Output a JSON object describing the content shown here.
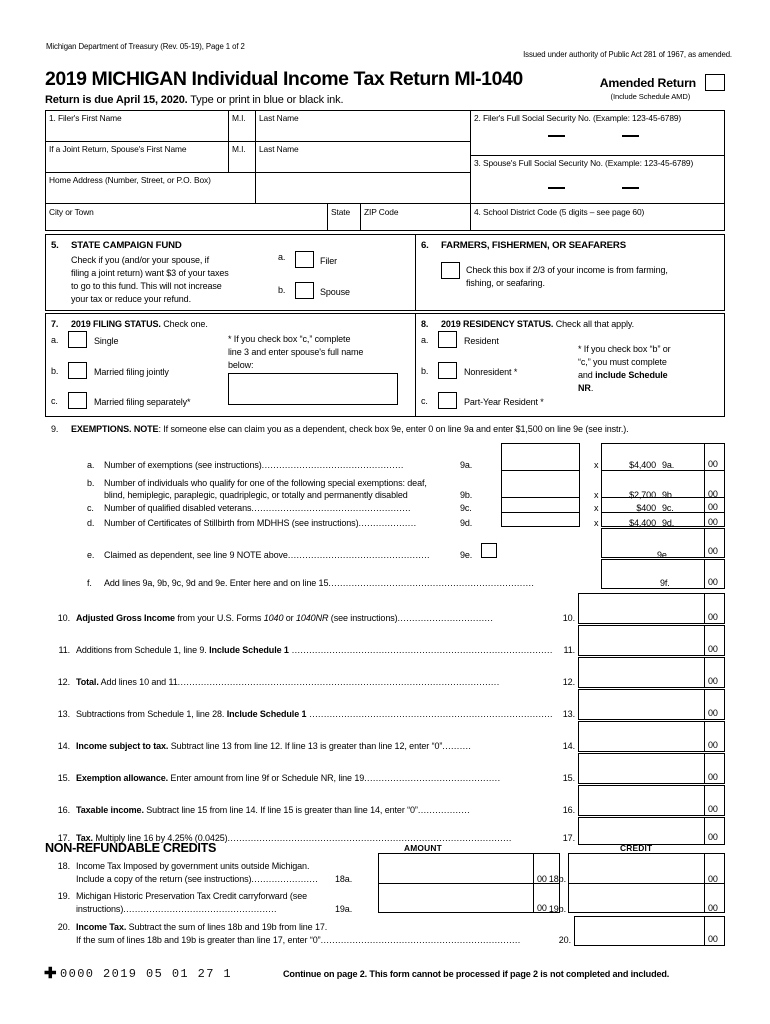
{
  "header": {
    "dept_line": "Michigan Department of Treasury (Rev. 05-19), Page 1 of 2",
    "authority_line": "Issued under authority of Public Act 281 of 1967, as amended.",
    "title": "2019 MICHIGAN Individual Income Tax Return MI-1040",
    "due_bold": "Return is due April 15, 2020.",
    "due_rest": " Type or print in blue or black ink.",
    "amended_label": "Amended Return",
    "amended_sub": "(Include Schedule AMD)"
  },
  "identity": {
    "filer_first_name": "1. Filer's First Name",
    "mi": "M.I.",
    "last_name": "Last Name",
    "spouse_first_name": "If a Joint Return, Spouse's First Name",
    "mi2": "M.I.",
    "last_name2": "Last Name",
    "home_address": "Home Address (Number, Street, or P.O. Box)",
    "city_or_town": "City or Town",
    "state": "State",
    "zip_code": "ZIP Code",
    "filer_ssn": "2. Filer's Full Social Security No. (Example: 123-45-6789)",
    "spouse_ssn": "3. Spouse's Full Social Security No. (Example: 123-45-6789)",
    "school_district": "4. School District Code (5 digits – see page 60)"
  },
  "campaign": {
    "num": "5.",
    "title": "STATE CAMPAIGN FUND",
    "line1": "Check if you (and/or your spouse, if",
    "line2": "filing a joint return) want $3 of your taxes",
    "line3": "to go to this fund. This will not increase",
    "line4": "your tax or reduce your refund.",
    "a_label": "a.",
    "a_text": "Filer",
    "b_label": "b.",
    "b_text": "Spouse"
  },
  "farmers": {
    "num": "6.",
    "title": "FARMERS, FISHERMEN, OR SEAFARERS",
    "line1": "Check this box if 2/3 of your income is from farming,",
    "line2": "fishing, or seafaring."
  },
  "filing_status": {
    "num": "7.",
    "title_bold": "2019 FILING STATUS.",
    "title_rest": " Check one.",
    "options": [
      {
        "letter": "a.",
        "label": "Single"
      },
      {
        "letter": "b.",
        "label": "Married filing jointly"
      },
      {
        "letter": "c.",
        "label": "Married filing separately*"
      }
    ],
    "note_line1": "* If you check box “c,” complete",
    "note_line2": "line 3 and enter spouse's full name",
    "note_line3": "below:",
    "spouse_name_value": ""
  },
  "residency_status": {
    "num": "8.",
    "title_bold": "2019 RESIDENCY STATUS.",
    "title_rest": " Check all that apply.",
    "options": [
      {
        "letter": "a.",
        "label": "Resident"
      },
      {
        "letter": "b.",
        "label": "Nonresident *"
      },
      {
        "letter": "c.",
        "label": "Part-Year Resident *"
      }
    ],
    "note_line1": "* If you check box “b” or",
    "note_line2": "“c,” you must complete",
    "note_line3_plain": "and ",
    "note_line3_bold": "include Schedule",
    "note_line4_bold": "NR",
    "note_line4_plain": "."
  },
  "exemptions": {
    "num": "9.",
    "heading_bold": "EXEMPTIONS.",
    "heading_note_bold": "NOTE",
    "heading_rest": ": If someone else can claim you as a dependent, check box 9e, enter 0 on line 9a and enter $1,500 on line 9e (see instr.).",
    "rows": [
      {
        "letter": "a.",
        "text": "Number of exemptions (see instructions)",
        "ref": "9a.",
        "mult": "x",
        "rate": "$4,400",
        "out_ref": "9a.",
        "cents": "00",
        "value": ""
      },
      {
        "letter": "b.",
        "text": "Number of individuals who qualify for one of the following special exemptions: deaf,",
        "text2": "blind, hemiplegic, paraplegic, quadriplegic, or totally and permanently disabled",
        "ref": "9b.",
        "mult": "x",
        "rate": "$2,700",
        "out_ref": "9b.",
        "cents": "00",
        "value": ""
      },
      {
        "letter": "c.",
        "text": "Number of qualified disabled veterans",
        "ref": "9c.",
        "mult": "x",
        "rate": "$400",
        "out_ref": "9c.",
        "cents": "00",
        "value": ""
      },
      {
        "letter": "d.",
        "text": "Number of Certificates of Stillbirth from MDHHS (see instructions)",
        "ref": "9d.",
        "mult": "x",
        "rate": "$4,400",
        "out_ref": "9d.",
        "cents": "00",
        "value": ""
      }
    ],
    "row_e": {
      "letter": "e.",
      "text": "Claimed as dependent, see line 9 NOTE above",
      "ref": "9e.",
      "out_ref": "9e.",
      "cents": "00",
      "value": ""
    },
    "row_f": {
      "letter": "f.",
      "text": "Add lines 9a, 9b, 9c, 9d and 9e.  Enter here and on line 15",
      "out_ref": "9f.",
      "cents": "00",
      "value": ""
    }
  },
  "lines": [
    {
      "num": "10.",
      "bold": "Adjusted Gross Income",
      "plain_parts": [
        " from your U.S. Forms "
      ],
      "italic1": "1040",
      "mid": " or ",
      "italic2": "1040NR",
      "tail": " (see instructions)",
      "ref": "10.",
      "cents": "00",
      "value": ""
    },
    {
      "num": "11.",
      "bold": "",
      "pre": "Additions from Schedule 1, line 9. ",
      "bold_tail": "Include Schedule 1",
      "ref": "11.",
      "cents": "00",
      "value": ""
    },
    {
      "num": "12.",
      "bold": "Total.",
      "tail": " Add lines 10 and 11",
      "ref": "12.",
      "cents": "00",
      "value": ""
    },
    {
      "num": "13.",
      "pre": "Subtractions from Schedule 1, line 28.  ",
      "bold_tail": "Include Schedule 1",
      "ref": "13.",
      "cents": "00",
      "value": ""
    },
    {
      "num": "14.",
      "bold": "Income subject to tax.",
      "tail": " Subtract line 13 from line 12.  If line 13 is greater than line 12, enter “0”",
      "ref": "14.",
      "cents": "00",
      "value": ""
    },
    {
      "num": "15.",
      "bold": "Exemption allowance.",
      "tail": " Enter amount from line 9f or Schedule NR, line 19",
      "ref": "15.",
      "cents": "00",
      "value": ""
    },
    {
      "num": "16.",
      "bold": "Taxable income.",
      "tail": " Subtract line 15 from line 14.  If line 15 is greater than line 14, enter “0”",
      "ref": "16.",
      "cents": "00",
      "value": ""
    },
    {
      "num": "17.",
      "bold": "Tax.",
      "tail": " Multiply line 16 by 4.25% (0.0425)",
      "ref": "17.",
      "cents": "00",
      "value": ""
    }
  ],
  "credits": {
    "section_title": "NON-REFUNDABLE CREDITS",
    "amount_header": "AMOUNT",
    "credit_header": "CREDIT",
    "row18": {
      "num": "18.",
      "line1": "Income Tax Imposed by government units outside Michigan.",
      "line2": "Include a copy of the return (see instructions)",
      "ref_a": "18a.",
      "cents_a": "00",
      "value_a": "",
      "ref_b": "18b.",
      "cents_b": "00",
      "value_b": ""
    },
    "row19": {
      "num": "19.",
      "line1": "Michigan Historic Preservation Tax Credit carryforward (see",
      "line2": "instructions)",
      "ref_a": "19a.",
      "cents_a": "00",
      "value_a": "",
      "ref_b": "19b.",
      "cents_b": "00",
      "value_b": ""
    },
    "row20": {
      "num": "20.",
      "bold": "Income Tax.",
      "line1_tail": " Subtract the sum of lines 18b and 19b from line 17.",
      "line2": "If the sum of lines 18b and 19b is greater than line 17, enter “0”",
      "ref": "20.",
      "cents": "00",
      "value": ""
    }
  },
  "footer": {
    "plus": "✚",
    "code": "0000 2019 05 01 27 1",
    "note": "Continue on page 2. This form cannot be processed if page 2 is not completed and included."
  }
}
